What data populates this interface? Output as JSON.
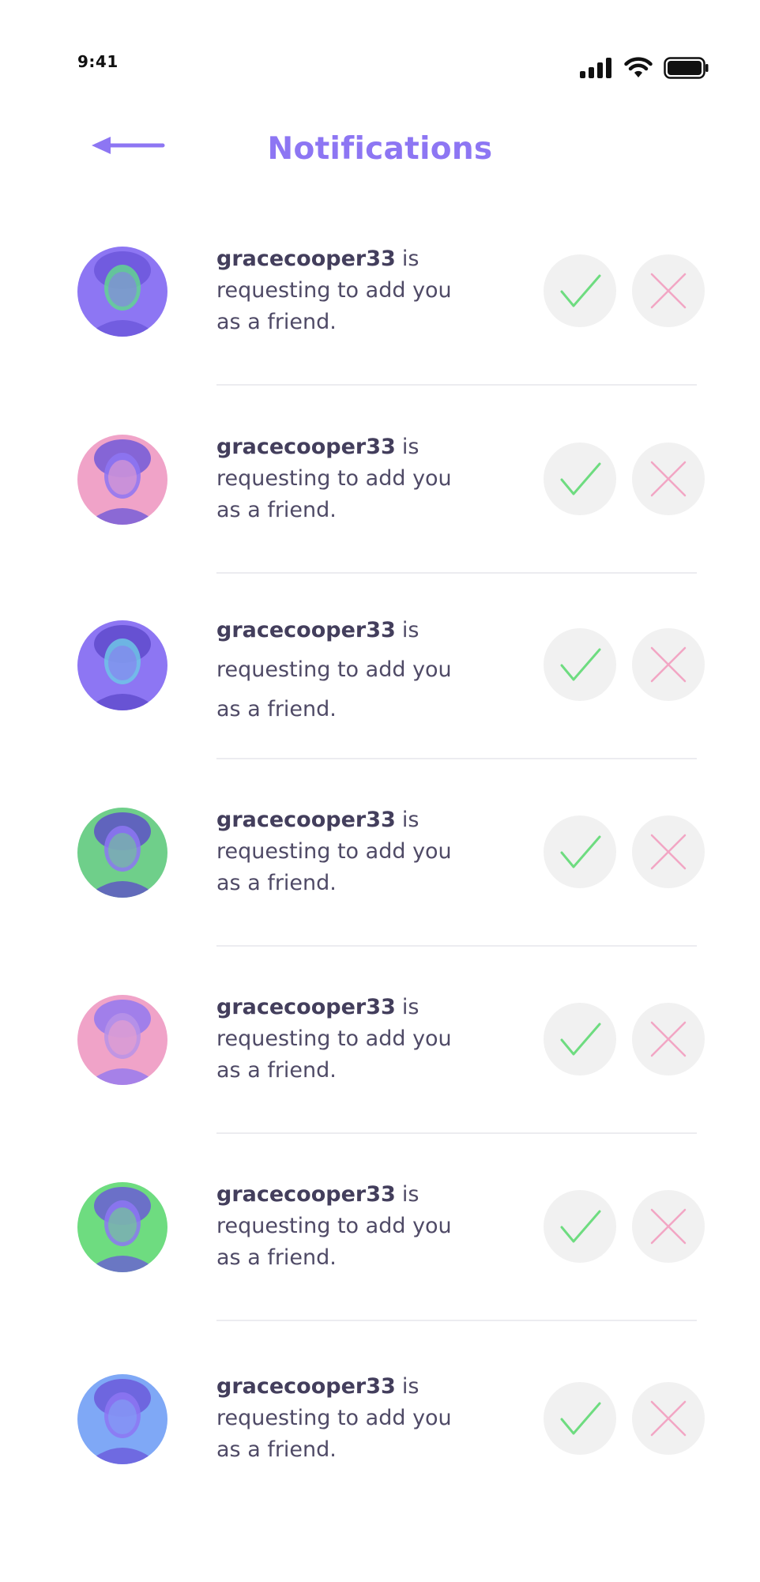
{
  "status_bar": {
    "time": "9:41",
    "icons": [
      "cellular-signal-icon",
      "wifi-icon",
      "battery-icon"
    ]
  },
  "header": {
    "title": "Notifications",
    "back_icon": "arrow-left-icon"
  },
  "colors": {
    "title": "#8d76f3",
    "accept": "#6edc80",
    "decline": "#f2a6c4",
    "button_bg": "#f1f1f1"
  },
  "notifications": [
    {
      "username": "gracecooper33",
      "suffix": "is",
      "line2": "requesting to add you",
      "line3": "as a friend.",
      "accept_icon": "check-icon",
      "decline_icon": "close-icon"
    },
    {
      "username": "gracecooper33",
      "suffix": "is",
      "line2": "requesting to add you",
      "line3": "as a friend.",
      "accept_icon": "check-icon",
      "decline_icon": "close-icon"
    },
    {
      "username": "gracecooper33",
      "suffix": "is",
      "line2": "requesting to add you",
      "line3": "as a friend.",
      "accept_icon": "check-icon",
      "decline_icon": "close-icon"
    },
    {
      "username": "gracecooper33",
      "suffix": "is",
      "line2": "requesting to add you",
      "line3": "as a friend.",
      "accept_icon": "check-icon",
      "decline_icon": "close-icon"
    },
    {
      "username": "gracecooper33",
      "suffix": "is",
      "line2": "requesting to add you",
      "line3": "as a friend.",
      "accept_icon": "check-icon",
      "decline_icon": "close-icon"
    },
    {
      "username": "gracecooper33",
      "suffix": "is",
      "line2": "requesting to add you",
      "line3": "as a friend.",
      "accept_icon": "check-icon",
      "decline_icon": "close-icon"
    },
    {
      "username": "gracecooper33",
      "suffix": "is",
      "line2": "requesting to add you",
      "line3": "as a friend.",
      "accept_icon": "check-icon",
      "decline_icon": "close-icon"
    }
  ]
}
